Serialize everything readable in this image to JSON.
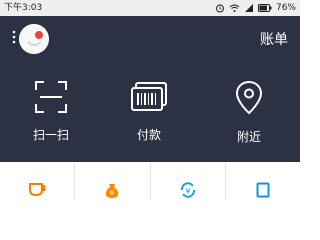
{
  "status": {
    "time": "下午3:03",
    "battery": "76%"
  },
  "header": {
    "bill_label": "账单"
  },
  "actions": [
    {
      "label": "扫一扫",
      "icon": "scan-icon"
    },
    {
      "label": "付款",
      "icon": "barcode-payment-icon"
    },
    {
      "label": "附近",
      "icon": "location-pin-icon"
    }
  ],
  "services": [
    {
      "icon": "cup-icon",
      "color": "#ff7a00"
    },
    {
      "icon": "money-bag-icon",
      "color": "#ff8a00"
    },
    {
      "icon": "currency-exchange-icon",
      "color": "#1aa0e6"
    },
    {
      "icon": "card-icon",
      "color": "#1a90e6"
    }
  ],
  "colors": {
    "header_bg": "#2c3143",
    "status_bg": "#efefef"
  }
}
